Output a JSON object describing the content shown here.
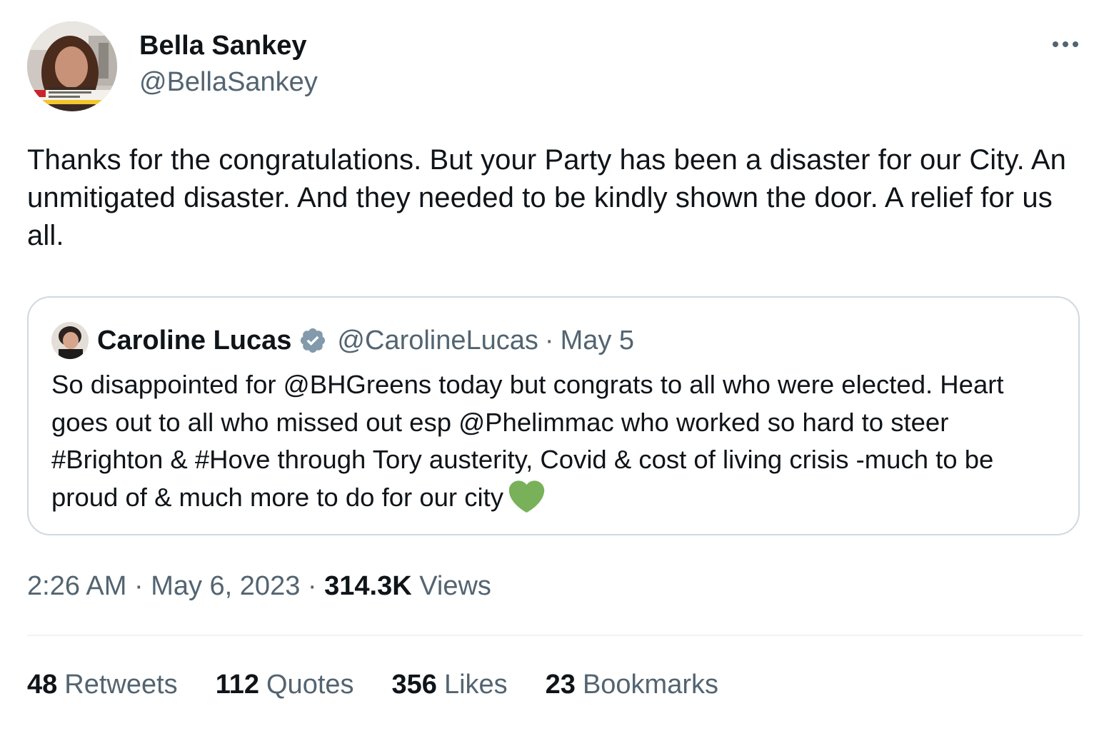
{
  "tweet": {
    "author": {
      "display_name": "Bella Sankey",
      "handle": "@BellaSankey",
      "avatar_icon": "profile-photo"
    },
    "more_icon": "more-horizontal-icon",
    "text": "Thanks for the congratulations. But your Party has been a disaster for our City. An unmitigated disaster. And they needed to be kindly shown the door. A relief for us all.",
    "quoted": {
      "display_name": "Caroline Lucas",
      "verified_icon": "verified-badge-icon",
      "verified_color": "#829aab",
      "handle": "@CarolineLucas",
      "separator": "·",
      "date": "May 5",
      "text": "So disappointed for @BHGreens today but congrats to all who were elected. Heart goes out to all who missed out esp @Phelimmac who worked so hard to steer #Brighton & #Hove through Tory austerity, Covid & cost of living crisis -much to be proud of & much more to do for our city",
      "emoji": "green-heart",
      "emoji_color": "#78b159"
    },
    "meta": {
      "time": "2:26 AM",
      "sep1": "·",
      "date": "May 6, 2023",
      "sep2": "·",
      "views_count": "314.3K",
      "views_label": "Views"
    },
    "stats": [
      {
        "count": "48",
        "label": "Retweets"
      },
      {
        "count": "112",
        "label": "Quotes"
      },
      {
        "count": "356",
        "label": "Likes"
      },
      {
        "count": "23",
        "label": "Bookmarks"
      }
    ]
  },
  "colors": {
    "text_primary": "#0f1419",
    "text_secondary": "#536471",
    "border": "#cfd9de",
    "divider": "#eff3f4"
  }
}
